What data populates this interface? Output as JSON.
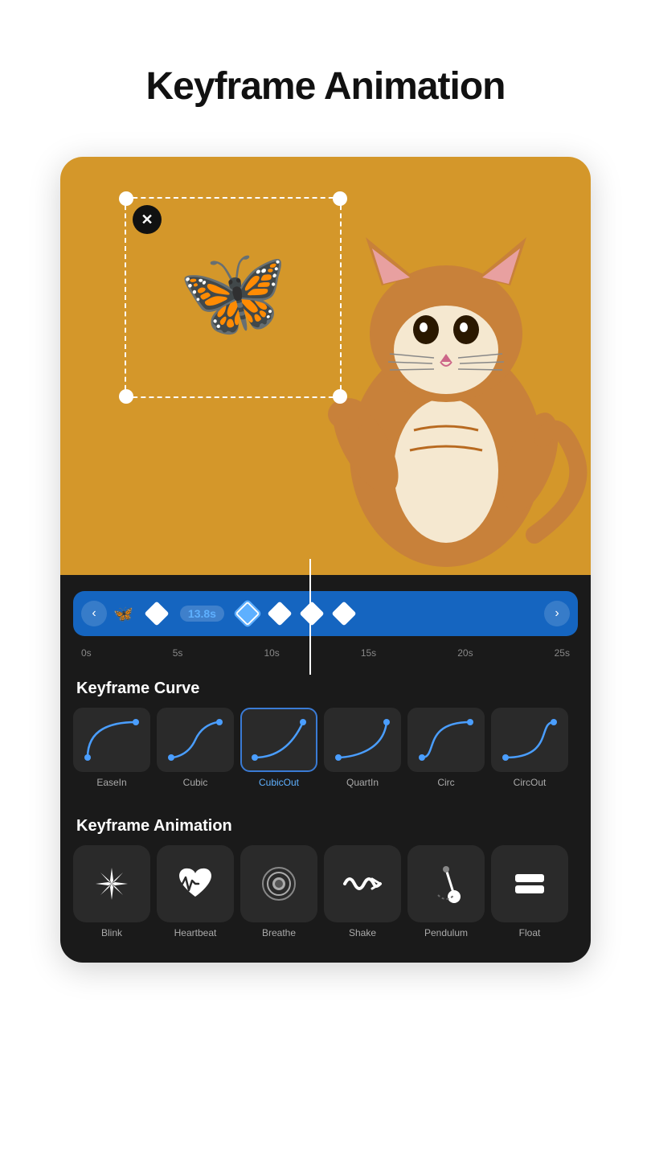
{
  "page": {
    "title": "Keyframe Animation"
  },
  "timeline": {
    "time_badge": "13.8s",
    "nav_left": "‹",
    "nav_right": "›",
    "times": [
      "0s",
      "5s",
      "10s",
      "15s",
      "20s",
      "25s"
    ],
    "butterfly_icon": "🦋"
  },
  "keyframe_curve": {
    "section_title": "Keyframe Curve",
    "items": [
      {
        "label": "EaseIn",
        "selected": false
      },
      {
        "label": "Cubic",
        "selected": false
      },
      {
        "label": "CubicOut",
        "selected": true
      },
      {
        "label": "QuartIn",
        "selected": false
      },
      {
        "label": "Circ",
        "selected": false
      },
      {
        "label": "CircOut",
        "selected": false
      }
    ]
  },
  "keyframe_animation": {
    "section_title": "Keyframe Animation",
    "items": [
      {
        "label": "Blink",
        "icon": "✦"
      },
      {
        "label": "Heartbeat",
        "icon": "💗"
      },
      {
        "label": "Breathe",
        "icon": "◎"
      },
      {
        "label": "Shake",
        "icon": "〰"
      },
      {
        "label": "Pendulum",
        "icon": "🎵"
      },
      {
        "label": "Float",
        "icon": "▬"
      }
    ]
  }
}
